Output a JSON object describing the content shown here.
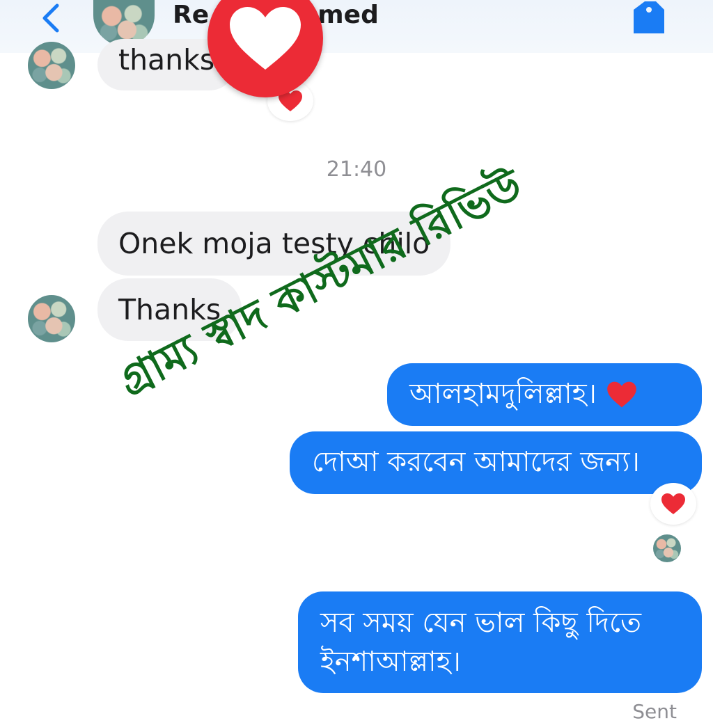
{
  "header": {
    "contact_name": "Re Ahmed",
    "back_icon": "chevron-left-icon",
    "tag_icon": "tag-icon"
  },
  "colors": {
    "accent": "#1a7cf4",
    "incoming_bubble": "#f0f0f2",
    "heart": "#ec2b36",
    "watermark": "#0f6a1c"
  },
  "messages": {
    "incoming_partial": "thanks",
    "timestamp": "21:40",
    "incoming_1": "Onek moja testy chilo",
    "incoming_2": "Thanks",
    "outgoing_1": "আলহামদুলিল্লাহ।",
    "outgoing_2": "দোআ করবেন আমাদের জন্য।",
    "outgoing_3_line1": "সব সময় যেন ভাল কিছু দিতে",
    "outgoing_3_line2": "ইনশাআল্লাহ।",
    "status": "Sent"
  },
  "overlay": {
    "watermark_text": "গ্রাম্য স্বাদ কাস্টমার রিভিউ"
  }
}
